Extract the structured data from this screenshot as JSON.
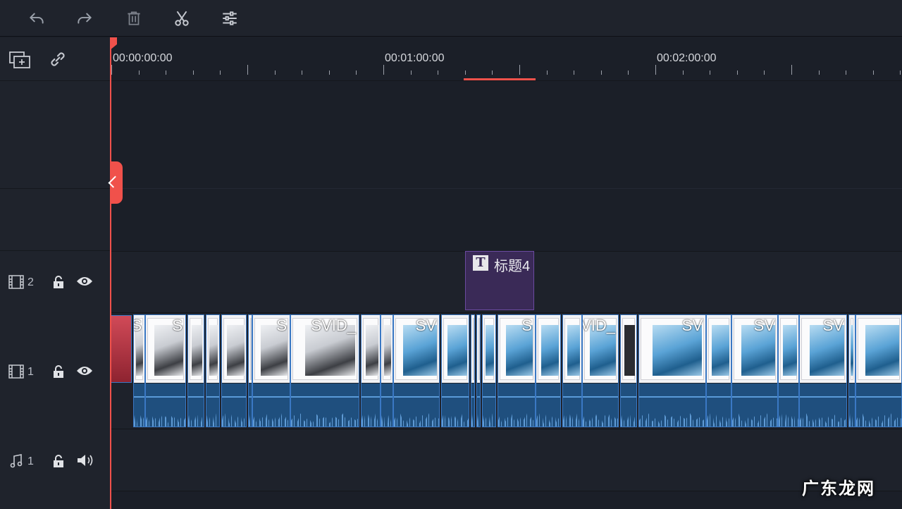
{
  "toolbar": {
    "undo": "undo-icon",
    "redo": "redo-icon",
    "delete": "trash-icon",
    "cut": "scissors-icon",
    "adjust": "sliders-icon"
  },
  "ruler": {
    "labels": [
      "00:00:00:00",
      "00:01:00:00",
      "00:02:00:00"
    ]
  },
  "tracks": {
    "video2": {
      "number": "2"
    },
    "video1": {
      "number": "1"
    },
    "audio1": {
      "number": "1"
    }
  },
  "title_clip": {
    "badge": "T",
    "label": "标题4"
  },
  "clips": [
    {
      "name": "S",
      "style": "gray"
    },
    {
      "name": "SVID_",
      "style": "gray"
    },
    {
      "name": "SV",
      "style": "blue"
    },
    {
      "name": "S",
      "style": "blue"
    },
    {
      "name": "SVID_",
      "style": "blue"
    },
    {
      "name": "SV",
      "style": "blue"
    },
    {
      "name": "SV",
      "style": "blue"
    },
    {
      "name": "SV",
      "style": "blue"
    }
  ],
  "colors": {
    "accent": "#f0514b",
    "clip_border": "#3a78c4",
    "title_clip": "#3a2a57",
    "audio": "#1f4f7e"
  },
  "watermark": "广东龙网"
}
